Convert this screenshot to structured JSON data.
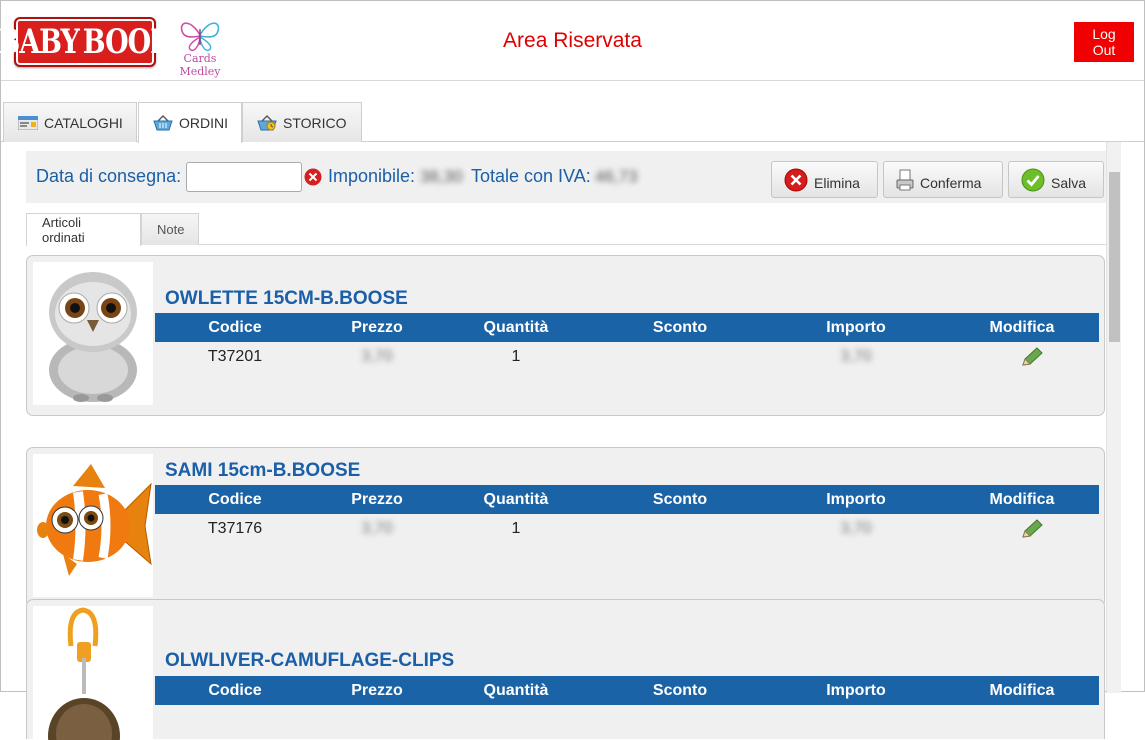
{
  "header": {
    "brand_left": "BABY",
    "brand_right": "BOOK",
    "brand2": "Cards Medley",
    "area_title": "Area Riservata",
    "logout_label": "Log Out"
  },
  "tabs": [
    {
      "label": "CATALOGHI",
      "icon": "catalog-icon"
    },
    {
      "label": "ORDINI",
      "icon": "basket-icon"
    },
    {
      "label": "STORICO",
      "icon": "basket-history-icon"
    }
  ],
  "order": {
    "delivery_label": "Data di consegna:",
    "delivery_value": "",
    "taxable_label": "Imponibile:",
    "taxable_value": "38,30",
    "total_label": "Totale con IVA:",
    "total_value": "46,73"
  },
  "actions": {
    "delete_label": "Elimina",
    "confirm_label": "Conferma",
    "save_label": "Salva"
  },
  "subtabs": [
    "Articoli ordinati",
    "Note"
  ],
  "columns": [
    "Codice",
    "Prezzo",
    "Quantità",
    "Sconto",
    "Importo",
    "Modifica"
  ],
  "products": [
    {
      "name": "OWLETTE 15CM-B.BOOSE",
      "code": "T37201",
      "price": "3,70",
      "qty": "1",
      "discount": "",
      "amount": "3,70"
    },
    {
      "name": "SAMI 15cm-B.BOOSE",
      "code": "T37176",
      "price": "3,70",
      "qty": "1",
      "discount": "",
      "amount": "3,70"
    },
    {
      "name": "OLWLIVER-CAMUFLAGE-CLIPS",
      "code": "",
      "price": "",
      "qty": "",
      "discount": "",
      "amount": ""
    }
  ],
  "colors": {
    "accent_blue": "#1a63a6",
    "title_red": "#e00000",
    "logout_red": "#f00000"
  }
}
